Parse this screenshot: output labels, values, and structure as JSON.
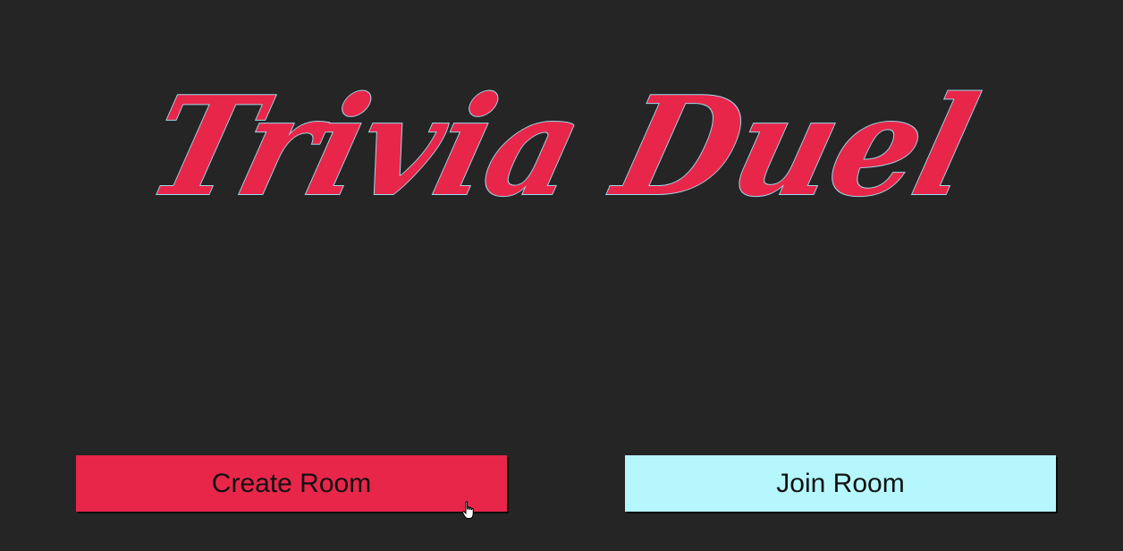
{
  "app": {
    "title": "Trivia Duel"
  },
  "actions": {
    "create_label": "Create Room",
    "join_label": "Join Room"
  },
  "colors": {
    "background": "#252525",
    "accent": "#e8264a",
    "secondary": "#b5f7fd",
    "title_outline": "#9fd7e6"
  },
  "icons": {
    "cursor": "hand-pointer-icon"
  }
}
